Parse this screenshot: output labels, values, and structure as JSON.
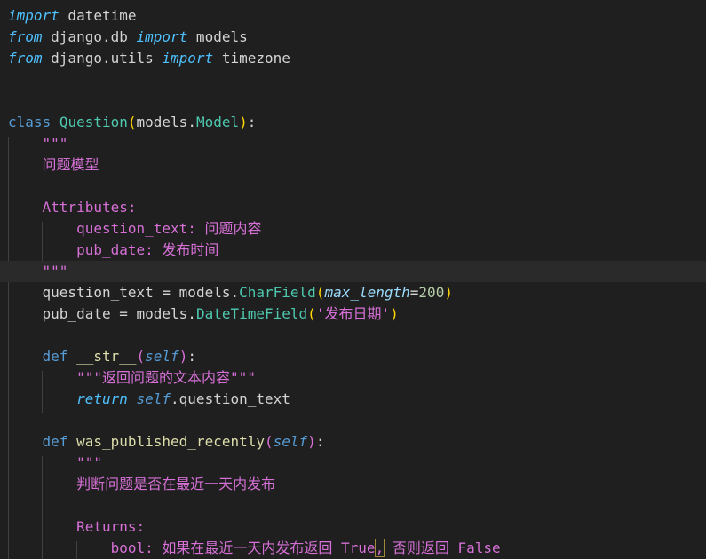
{
  "editor": {
    "theme": {
      "background": "#1f1f1f",
      "current_line": "#2a2a2a",
      "keyword_control": "#4fc1ff",
      "keyword": "#569cd6",
      "class_name": "#4ec9b0",
      "function_name": "#dcdcaa",
      "docstring": "#d670d6",
      "number": "#b5cea8"
    },
    "lines": [
      {
        "tokens": [
          {
            "t": "import",
            "c": "kw-ctrl"
          },
          {
            "t": " datetime",
            "c": "ident"
          }
        ]
      },
      {
        "tokens": [
          {
            "t": "from",
            "c": "kw-ctrl"
          },
          {
            "t": " django.db ",
            "c": "ident"
          },
          {
            "t": "import",
            "c": "kw-ctrl"
          },
          {
            "t": " models",
            "c": "ident"
          }
        ]
      },
      {
        "tokens": [
          {
            "t": "from",
            "c": "kw-ctrl"
          },
          {
            "t": " django.utils ",
            "c": "ident"
          },
          {
            "t": "import",
            "c": "kw-ctrl"
          },
          {
            "t": " timezone",
            "c": "ident"
          }
        ]
      },
      {
        "tokens": []
      },
      {
        "tokens": []
      },
      {
        "tokens": [
          {
            "t": "class",
            "c": "kw"
          },
          {
            "t": " ",
            "c": "ident"
          },
          {
            "t": "Question",
            "c": "cls"
          },
          {
            "t": "(",
            "c": "paren1"
          },
          {
            "t": "models",
            "c": "ident"
          },
          {
            "t": ".",
            "c": "op"
          },
          {
            "t": "Model",
            "c": "cls"
          },
          {
            "t": ")",
            "c": "paren1"
          },
          {
            "t": ":",
            "c": "op"
          }
        ]
      },
      {
        "tokens": [
          {
            "t": "    \"\"\"",
            "c": "doc"
          }
        ]
      },
      {
        "tokens": [
          {
            "t": "    问题模型",
            "c": "doc"
          }
        ]
      },
      {
        "tokens": []
      },
      {
        "tokens": [
          {
            "t": "    Attributes:",
            "c": "doc"
          }
        ]
      },
      {
        "tokens": [
          {
            "t": "        question_text: 问题内容",
            "c": "doc"
          }
        ]
      },
      {
        "tokens": [
          {
            "t": "        pub_date: 发布时间",
            "c": "doc"
          }
        ]
      },
      {
        "tokens": [
          {
            "t": "    \"\"\"",
            "c": "doc"
          }
        ],
        "current": true
      },
      {
        "tokens": [
          {
            "t": "    question_text",
            "c": "ident"
          },
          {
            "t": " = ",
            "c": "op"
          },
          {
            "t": "models",
            "c": "ident"
          },
          {
            "t": ".",
            "c": "op"
          },
          {
            "t": "CharField",
            "c": "cls"
          },
          {
            "t": "(",
            "c": "paren1"
          },
          {
            "t": "max_length",
            "c": "param"
          },
          {
            "t": "=",
            "c": "op"
          },
          {
            "t": "200",
            "c": "num"
          },
          {
            "t": ")",
            "c": "paren1"
          }
        ]
      },
      {
        "tokens": [
          {
            "t": "    pub_date",
            "c": "ident"
          },
          {
            "t": " = ",
            "c": "op"
          },
          {
            "t": "models",
            "c": "ident"
          },
          {
            "t": ".",
            "c": "op"
          },
          {
            "t": "DateTimeField",
            "c": "cls"
          },
          {
            "t": "(",
            "c": "paren1"
          },
          {
            "t": "'发布日期'",
            "c": "doc"
          },
          {
            "t": ")",
            "c": "paren1"
          }
        ]
      },
      {
        "tokens": []
      },
      {
        "tokens": [
          {
            "t": "    def",
            "c": "kw"
          },
          {
            "t": " ",
            "c": "ident"
          },
          {
            "t": "__str__",
            "c": "fn"
          },
          {
            "t": "(",
            "c": "paren2"
          },
          {
            "t": "self",
            "c": "self"
          },
          {
            "t": ")",
            "c": "paren2"
          },
          {
            "t": ":",
            "c": "op"
          }
        ]
      },
      {
        "tokens": [
          {
            "t": "        \"\"\"返回问题的文本内容\"\"\"",
            "c": "doc"
          }
        ]
      },
      {
        "tokens": [
          {
            "t": "        return",
            "c": "kw-ctrl"
          },
          {
            "t": " ",
            "c": "ident"
          },
          {
            "t": "self",
            "c": "self"
          },
          {
            "t": ".question_text",
            "c": "ident"
          }
        ]
      },
      {
        "tokens": []
      },
      {
        "tokens": [
          {
            "t": "    def",
            "c": "kw"
          },
          {
            "t": " ",
            "c": "ident"
          },
          {
            "t": "was_published_recently",
            "c": "fn"
          },
          {
            "t": "(",
            "c": "paren2"
          },
          {
            "t": "self",
            "c": "self"
          },
          {
            "t": ")",
            "c": "paren2"
          },
          {
            "t": ":",
            "c": "op"
          }
        ]
      },
      {
        "tokens": [
          {
            "t": "        \"\"\"",
            "c": "doc"
          }
        ]
      },
      {
        "tokens": [
          {
            "t": "        判断问题是否在最近一天内发布",
            "c": "doc"
          }
        ]
      },
      {
        "tokens": []
      },
      {
        "tokens": [
          {
            "t": "        Returns:",
            "c": "doc"
          }
        ]
      },
      {
        "tokens": [
          {
            "t": "            bool: 如果在最近一天内发布返回 True",
            "c": "doc"
          },
          {
            "t": ",",
            "c": "doc",
            "hl": true
          },
          {
            "t": " 否则返回 False",
            "c": "doc"
          }
        ]
      }
    ]
  }
}
